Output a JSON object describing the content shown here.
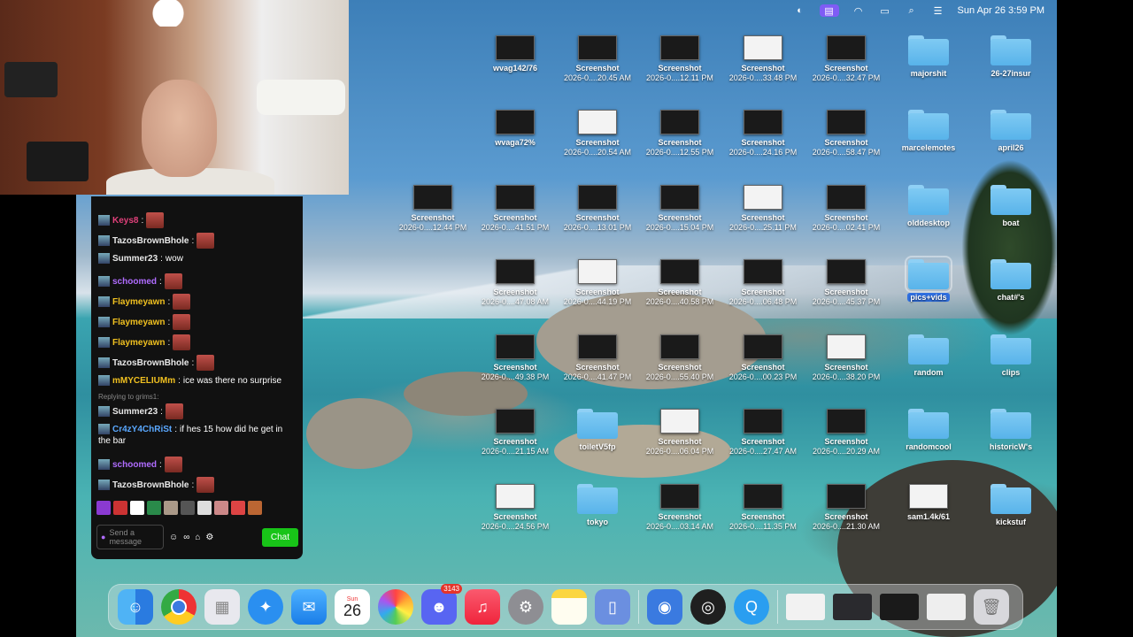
{
  "menubar": {
    "icons": [
      "control-icon",
      "screen-share-icon",
      "wifi-icon",
      "battery-icon",
      "search-icon",
      "control-center-icon"
    ],
    "datetime": "Sun Apr 26  3:59 PM"
  },
  "desktop_items": [
    {
      "type": "file",
      "label1": "wvag142/76",
      "label2": ""
    },
    {
      "type": "file",
      "label1": "Screenshot",
      "label2": "2026-0....20.45 AM"
    },
    {
      "type": "file",
      "label1": "Screenshot",
      "label2": "2026-0....12.11 PM"
    },
    {
      "type": "file",
      "label1": "Screenshot",
      "label2": "2026-0....33.48 PM"
    },
    {
      "type": "file",
      "label1": "Screenshot",
      "label2": "2026-0....32.47 PM"
    },
    {
      "type": "folder",
      "label1": "majorshit",
      "label2": ""
    },
    {
      "type": "folder",
      "label1": "26-27insur",
      "label2": ""
    },
    {
      "type": "file",
      "label1": "wvaga72%",
      "label2": ""
    },
    {
      "type": "file",
      "label1": "Screenshot",
      "label2": "2026-0....20.54 AM"
    },
    {
      "type": "file",
      "label1": "Screenshot",
      "label2": "2026-0....12.55 PM"
    },
    {
      "type": "file",
      "label1": "Screenshot",
      "label2": "2026-0....24.16 PM"
    },
    {
      "type": "file",
      "label1": "Screenshot",
      "label2": "2026-0....58.47 PM"
    },
    {
      "type": "folder",
      "label1": "marcelemotes",
      "label2": ""
    },
    {
      "type": "folder",
      "label1": "april26",
      "label2": ""
    },
    {
      "type": "file",
      "label1": "Screenshot",
      "label2": "2026-0....12.44 PM"
    },
    {
      "type": "file",
      "label1": "Screenshot",
      "label2": "2026-0....41.51 PM"
    },
    {
      "type": "file",
      "label1": "Screenshot",
      "label2": "2026-0....13.01 PM"
    },
    {
      "type": "file",
      "label1": "Screenshot",
      "label2": "2026-0....15.04 PM"
    },
    {
      "type": "file",
      "label1": "Screenshot",
      "label2": "2026-0....25.11 PM"
    },
    {
      "type": "file",
      "label1": "Screenshot",
      "label2": "2026-0....02.41 PM"
    },
    {
      "type": "folder",
      "label1": "olddesktop",
      "label2": ""
    },
    {
      "type": "folder",
      "label1": "boat",
      "label2": ""
    },
    {
      "type": "file",
      "label1": "Screenshot",
      "label2": "2026-0....47.08 AM"
    },
    {
      "type": "file",
      "label1": "Screenshot",
      "label2": "2026-0....44.19 PM"
    },
    {
      "type": "file",
      "label1": "Screenshot",
      "label2": "2026-0....40.58 PM"
    },
    {
      "type": "file",
      "label1": "Screenshot",
      "label2": "2026-0....06.48 PM"
    },
    {
      "type": "file",
      "label1": "Screenshot",
      "label2": "2026-0....45.37 PM"
    },
    {
      "type": "folder",
      "label1": "pics+vids",
      "label2": "",
      "selected": true
    },
    {
      "type": "folder",
      "label1": "chat#'s",
      "label2": ""
    },
    {
      "type": "file",
      "label1": "Screenshot",
      "label2": "2026-0....49.38 PM"
    },
    {
      "type": "file",
      "label1": "Screenshot",
      "label2": "2026-0....41.47 PM"
    },
    {
      "type": "file",
      "label1": "Screenshot",
      "label2": "2026-0....55.40 PM"
    },
    {
      "type": "file",
      "label1": "Screenshot",
      "label2": "2026-0....00.23 PM"
    },
    {
      "type": "file",
      "label1": "Screenshot",
      "label2": "2026-0....38.20 PM"
    },
    {
      "type": "folder",
      "label1": "random",
      "label2": ""
    },
    {
      "type": "folder",
      "label1": "clips",
      "label2": ""
    },
    {
      "type": "file",
      "label1": "Screenshot",
      "label2": "2026-0....21.15 AM"
    },
    {
      "type": "folder",
      "label1": "toiletV5fp",
      "label2": ""
    },
    {
      "type": "file",
      "label1": "Screenshot",
      "label2": "2026-0....06.04 PM"
    },
    {
      "type": "file",
      "label1": "Screenshot",
      "label2": "2026-0....27.47 AM"
    },
    {
      "type": "file",
      "label1": "Screenshot",
      "label2": "2026-0....20.29 AM"
    },
    {
      "type": "folder",
      "label1": "randomcool",
      "label2": ""
    },
    {
      "type": "folder",
      "label1": "historicW's",
      "label2": ""
    },
    {
      "type": "file",
      "label1": "Screenshot",
      "label2": "2026-0....24.56 PM"
    },
    {
      "type": "folder",
      "label1": "tokyo",
      "label2": ""
    },
    {
      "type": "file",
      "label1": "Screenshot",
      "label2": "2026-0....03.14 AM"
    },
    {
      "type": "file",
      "label1": "Screenshot",
      "label2": "2026-0....11.35 PM"
    },
    {
      "type": "file",
      "label1": "Screenshot",
      "label2": "2026-0....21.30 AM"
    },
    {
      "type": "file",
      "label1": "sam1.4k/61",
      "label2": ""
    },
    {
      "type": "folder",
      "label1": "kickstuf",
      "label2": ""
    }
  ],
  "chat": {
    "messages": [
      {
        "user": "Keys8",
        "color": "#e0407a",
        "text": ""
      },
      {
        "user": "TazosBrownBhole",
        "color": "#e8e8e8",
        "text": ""
      },
      {
        "user": "Summer23",
        "color": "#e8e8e8",
        "text": "wow"
      },
      {
        "user": "schoomed",
        "color": "#b06cff",
        "text": ""
      },
      {
        "user": "Flaymeyawn",
        "color": "#f0c020",
        "text": ""
      },
      {
        "user": "Flaymeyawn",
        "color": "#f0c020",
        "text": ""
      },
      {
        "user": "Flaymeyawn",
        "color": "#f0c020",
        "text": ""
      },
      {
        "user": "TazosBrownBhole",
        "color": "#e8e8e8",
        "text": ""
      },
      {
        "user": "mMYCELIUMm",
        "color": "#f0c020",
        "text": "ice was there no surprise"
      },
      {
        "user": "Summer23",
        "color": "#e8e8e8",
        "text": ""
      },
      {
        "user": "Cr4zY4ChRiSt",
        "color": "#5aa8ff",
        "text": "if hes 15 how did he get in"
      },
      {
        "user": "",
        "color": "#e8e8e8",
        "text": "the bar"
      },
      {
        "user": "schoomed",
        "color": "#b06cff",
        "text": ""
      },
      {
        "user": "TazosBrownBhole",
        "color": "#e8e8e8",
        "text": ""
      }
    ],
    "reply_hint": "Replying to grims1:",
    "input_placeholder": "Send a message",
    "send_label": "Chat"
  },
  "dock": {
    "calendar_day_label": "Sun",
    "calendar_day": "26",
    "discord_badge": "3143",
    "apps": [
      "finder-icon",
      "chrome-icon",
      "launchpad-icon",
      "safari-icon",
      "mail-icon",
      "calendar-icon",
      "photos-icon",
      "discord-icon",
      "music-icon",
      "settings-icon",
      "notes-icon",
      "preview-icon",
      "vpn-icon",
      "obs-icon",
      "quicktime-icon"
    ]
  }
}
